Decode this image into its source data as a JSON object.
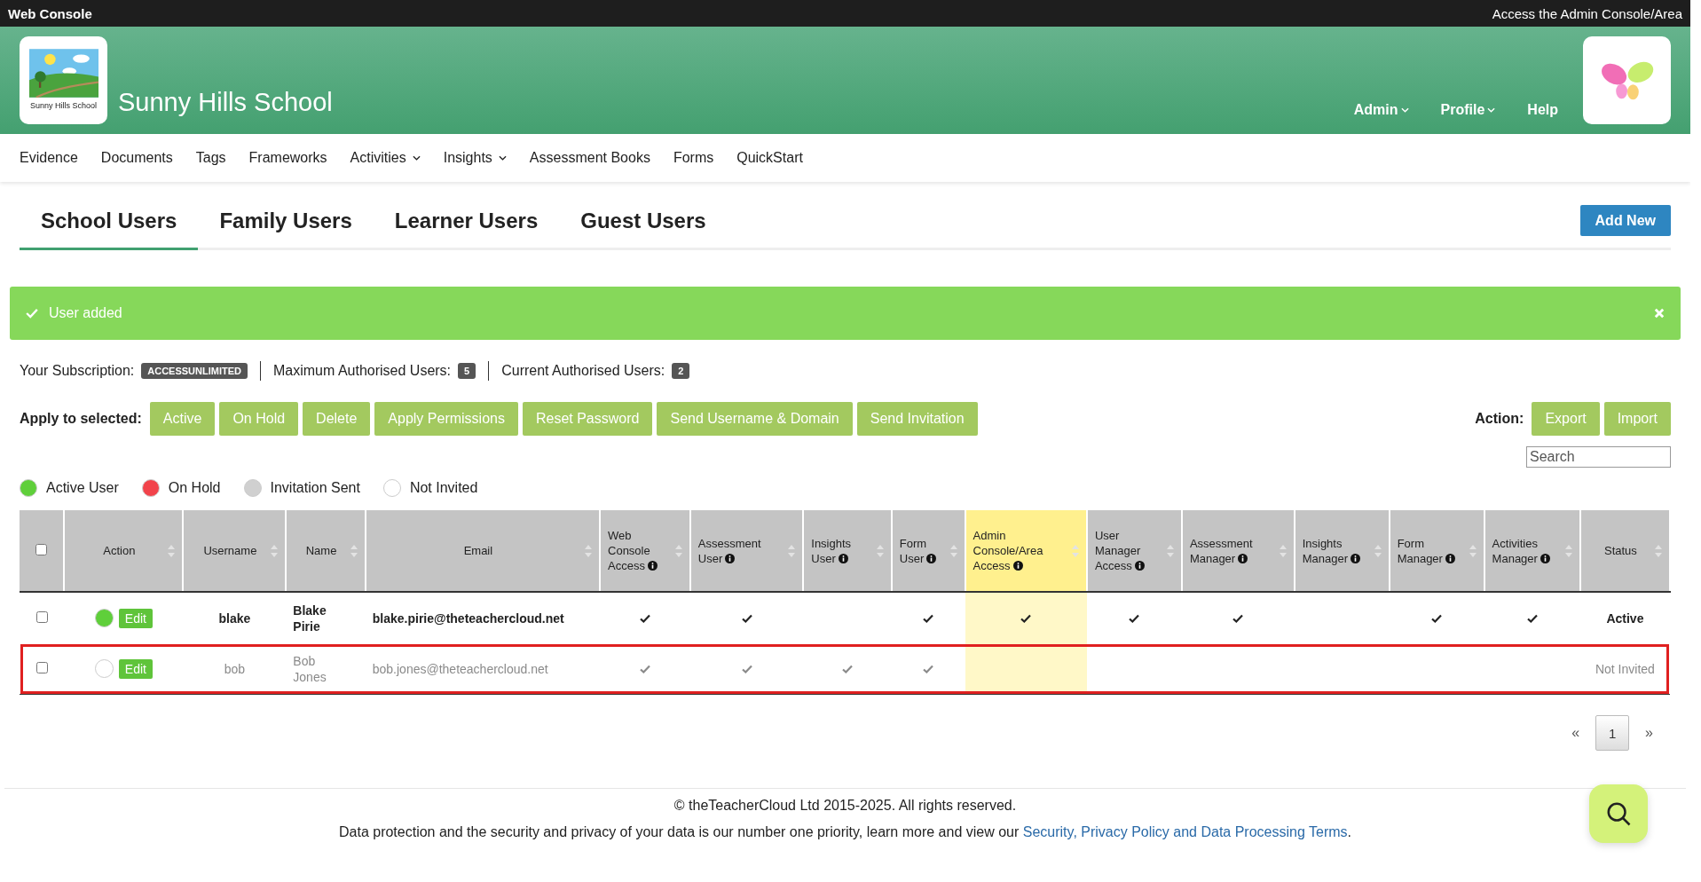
{
  "top_bar": {
    "title": "Web Console",
    "link": "Access the Admin Console/Area"
  },
  "header": {
    "school_name": "Sunny Hills School",
    "logo_caption": "Sunny Hills School",
    "menu": [
      {
        "label": "Admin",
        "dropdown": true
      },
      {
        "label": "Profile",
        "dropdown": true
      },
      {
        "label": "Help",
        "dropdown": false
      }
    ]
  },
  "nav": [
    {
      "label": "Evidence",
      "dropdown": false
    },
    {
      "label": "Documents",
      "dropdown": false
    },
    {
      "label": "Tags",
      "dropdown": false
    },
    {
      "label": "Frameworks",
      "dropdown": false
    },
    {
      "label": "Activities",
      "dropdown": true
    },
    {
      "label": "Insights",
      "dropdown": true
    },
    {
      "label": "Assessment Books",
      "dropdown": false
    },
    {
      "label": "Forms",
      "dropdown": false
    },
    {
      "label": "QuickStart",
      "dropdown": false
    }
  ],
  "tabs": [
    {
      "label": "School Users",
      "selected": true
    },
    {
      "label": "Family Users",
      "selected": false
    },
    {
      "label": "Learner Users",
      "selected": false
    },
    {
      "label": "Guest Users",
      "selected": false
    }
  ],
  "add_button": "Add New",
  "alert": {
    "message": "User added"
  },
  "subscription": [
    {
      "label": "Your Subscription:",
      "badge": "ACCESSUNLIMITED"
    },
    {
      "label": "Maximum Authorised Users:",
      "badge": "5"
    },
    {
      "label": "Current Authorised Users:",
      "badge": "2"
    }
  ],
  "apply": {
    "label": "Apply to selected:",
    "buttons": [
      "Active",
      "On Hold",
      "Delete",
      "Apply Permissions",
      "Reset Password",
      "Send Username & Domain",
      "Send Invitation"
    ]
  },
  "action": {
    "label": "Action:",
    "buttons": [
      "Export",
      "Import"
    ]
  },
  "search": {
    "placeholder": "Search"
  },
  "legend": [
    {
      "label": "Active User",
      "color": "#5fcf3a"
    },
    {
      "label": "On Hold",
      "color": "#f2434b"
    },
    {
      "label": "Invitation Sent",
      "color": "#d0d0d0"
    },
    {
      "label": "Not Invited",
      "color": "#ffffff"
    }
  ],
  "table": {
    "select_all": {
      "checked": false
    },
    "columns": [
      {
        "label": "Action",
        "info": false,
        "highlighted": false
      },
      {
        "label": "Username",
        "info": false,
        "highlighted": false
      },
      {
        "label": "Name",
        "info": false,
        "highlighted": false
      },
      {
        "label": "Email",
        "info": false,
        "highlighted": false
      },
      {
        "label": "Web Console Access",
        "info": true,
        "highlighted": false
      },
      {
        "label": "Assessment User",
        "info": true,
        "highlighted": false
      },
      {
        "label": "Insights User",
        "info": true,
        "highlighted": false
      },
      {
        "label": "Form User",
        "info": true,
        "highlighted": false
      },
      {
        "label": "Admin Console/Area Access",
        "info": true,
        "highlighted": true
      },
      {
        "label": "User Manager Access",
        "info": true,
        "highlighted": false
      },
      {
        "label": "Assessment Manager",
        "info": true,
        "highlighted": false
      },
      {
        "label": "Insights Manager",
        "info": true,
        "highlighted": false
      },
      {
        "label": "Form Manager",
        "info": true,
        "highlighted": false
      },
      {
        "label": "Activities Manager",
        "info": true,
        "highlighted": false
      },
      {
        "label": "Status",
        "info": false,
        "highlighted": false
      }
    ],
    "rows": [
      {
        "checked": false,
        "color": "#5fcf3a",
        "edit": "Edit",
        "username": "blake",
        "name": "Blake Pirie",
        "email": "blake.pirie@theteachercloud.net",
        "permissions": [
          true,
          true,
          false,
          true,
          true,
          true,
          true,
          false,
          true,
          true
        ],
        "status": "Active",
        "dimmed": false,
        "highlighted": false
      },
      {
        "checked": false,
        "color": "#ffffff",
        "edit": "Edit",
        "username": "bob",
        "name": "Bob Jones",
        "email": "bob.jones@theteachercloud.net",
        "permissions": [
          true,
          true,
          true,
          true,
          false,
          false,
          false,
          false,
          false,
          false
        ],
        "status": "Not Invited",
        "dimmed": true,
        "highlighted": true
      }
    ]
  },
  "pagination": {
    "prev": "«",
    "pages": [
      {
        "label": "1",
        "selected": true
      }
    ],
    "next": "»"
  },
  "footer": {
    "copyright": "© theTeacherCloud Ltd 2015-2025. All rights reserved.",
    "notice": "Data protection and the security and privacy of your data is our number one priority, learn more and view our ",
    "link": "Security, Privacy Policy and Data Processing Terms",
    "notice_end": "."
  }
}
